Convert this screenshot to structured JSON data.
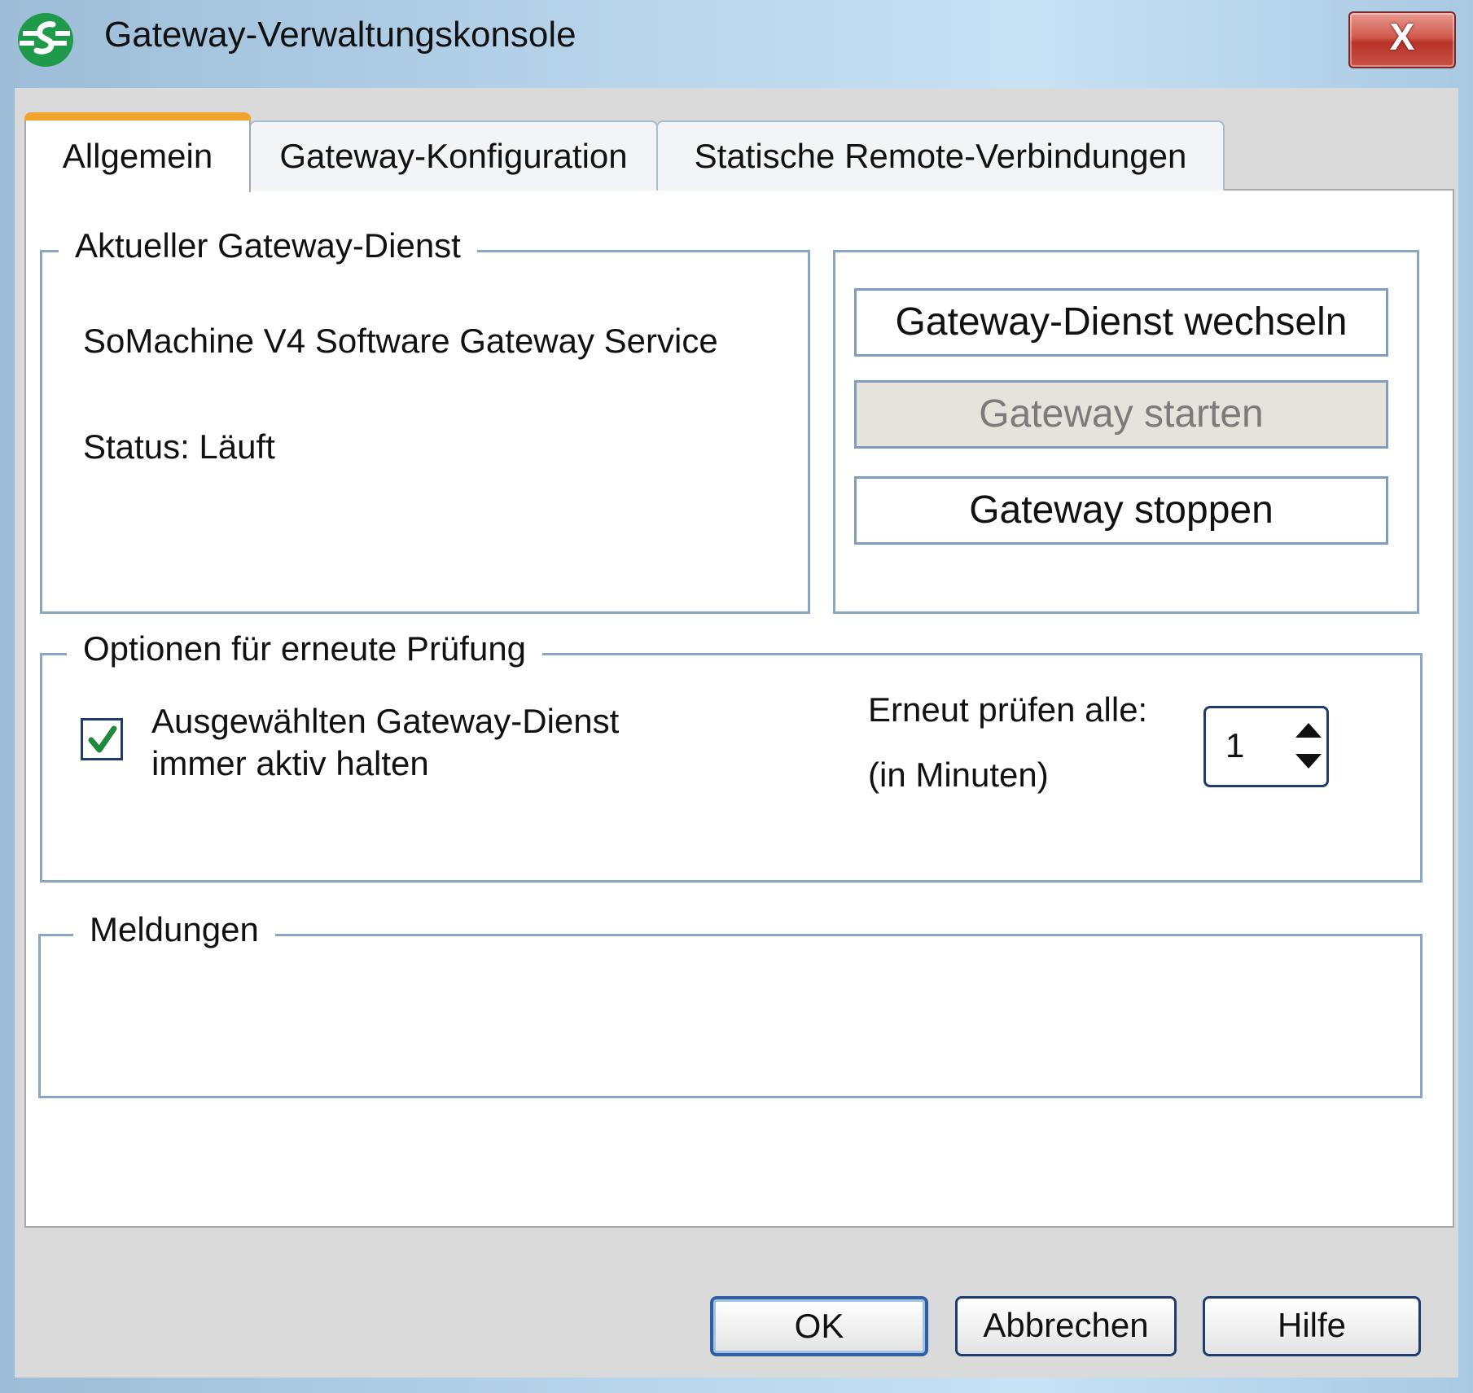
{
  "window": {
    "title": "Gateway-Verwaltungskonsole",
    "close_label": "X"
  },
  "tabs": [
    {
      "label": "Allgemein",
      "active": true
    },
    {
      "label": "Gateway-Konfiguration",
      "active": false
    },
    {
      "label": "Statische Remote-Verbindungen",
      "active": false
    }
  ],
  "current_service": {
    "legend": "Aktueller Gateway-Dienst",
    "name": "SoMachine V4 Software Gateway Service",
    "status": "Status: Läuft"
  },
  "actions": {
    "switch_service": "Gateway-Dienst wechseln",
    "start_gateway": "Gateway starten",
    "stop_gateway": "Gateway stoppen"
  },
  "recheck": {
    "legend": "Optionen für erneute Prüfung",
    "keep_active_line1": "Ausgewählten Gateway-Dienst",
    "keep_active_line2": "immer aktiv halten",
    "keep_active_checked": true,
    "interval_label": "Erneut prüfen alle:",
    "interval_unit": "(in Minuten)",
    "interval_value": "1"
  },
  "messages": {
    "legend": "Meldungen"
  },
  "footer": {
    "ok": "OK",
    "cancel": "Abbrechen",
    "help": "Hilfe"
  },
  "colors": {
    "tab_accent": "#f0a42a",
    "group_border": "#8aa6c4",
    "checkmark": "#1f8a3c",
    "close_button": "#c94a3f"
  }
}
